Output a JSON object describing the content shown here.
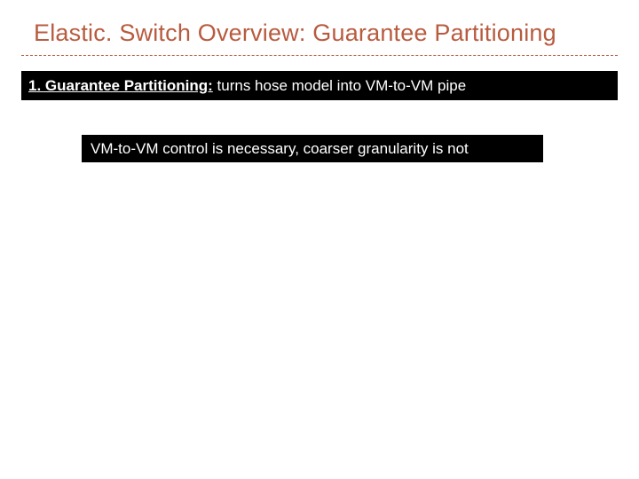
{
  "title": "Elastic. Switch Overview: Guarantee Partitioning",
  "bar1": {
    "lead": "1. Guarantee Partitioning:",
    "rest": " turns hose model into VM-to-VM pipe"
  },
  "bar2": {
    "text": "VM-to-VM control is necessary, coarser granularity is not"
  }
}
